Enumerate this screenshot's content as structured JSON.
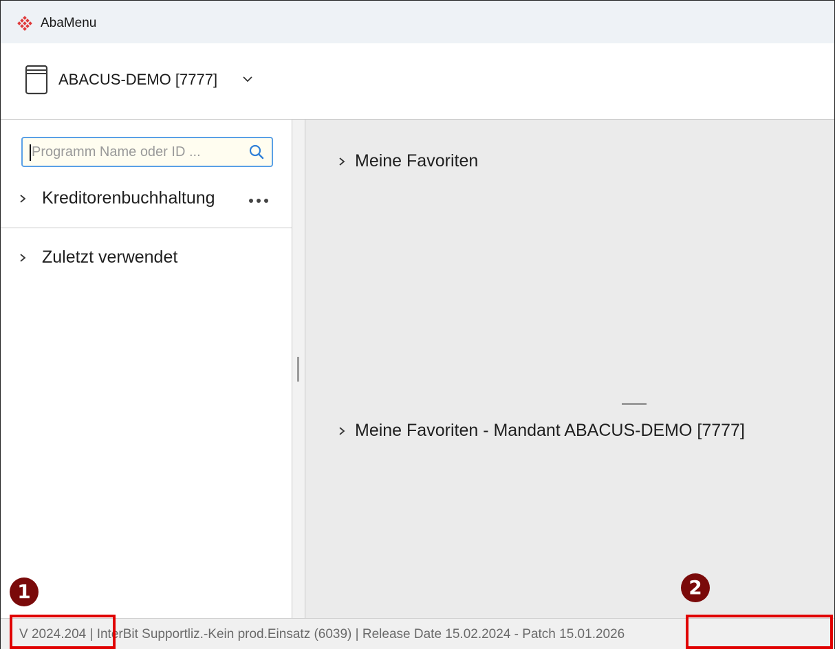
{
  "window": {
    "title": "AbaMenu",
    "logo_icon": "abacus-diamond-logo-icon",
    "accent_color": "#e03a3a"
  },
  "header": {
    "tenant_label": "ABACUS-DEMO [7777]",
    "tenant_icon": "book-icon"
  },
  "sidebar": {
    "search_placeholder": "Programm Name oder ID ...",
    "search_value": "",
    "items": [
      {
        "label": "Kreditorenbuchhaltung",
        "has_more": true
      },
      {
        "label": "Zuletzt verwendet",
        "has_more": false
      }
    ]
  },
  "main": {
    "sections": [
      {
        "label": "Meine Favoriten"
      },
      {
        "label": "Meine Favoriten - Mandant ABACUS-DEMO [7777]"
      }
    ]
  },
  "statusbar": {
    "version": "V 2024.204",
    "separator1": " | ",
    "license": "InterBit Supportliz.-Kein prod.Einsatz (6039)",
    "separator2": " | ",
    "release": "Release Date 15.02.2024",
    "separator3": " - ",
    "patch": "Patch 15.01.2026"
  },
  "annotations": {
    "marker1": "1",
    "marker2": "2",
    "highlight_color": "#e00000",
    "marker_color": "#7a0a0a"
  }
}
